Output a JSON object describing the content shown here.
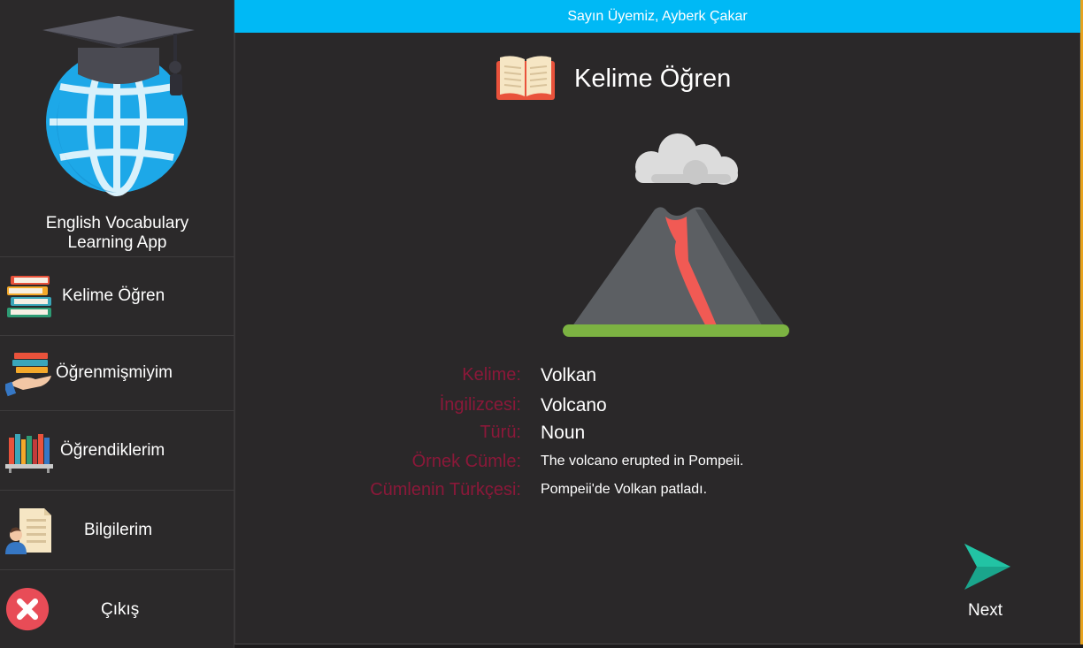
{
  "app": {
    "title_line1": "English Vocabulary",
    "title_line2": "Learning App"
  },
  "header": {
    "greeting": "Sayın Üyemiz, Ayberk Çakar"
  },
  "sidebar": {
    "items": [
      {
        "label": "Kelime Öğren",
        "icon": "books-stack-icon"
      },
      {
        "label": "Öğrenmişmiyim",
        "icon": "hand-books-icon"
      },
      {
        "label": "Öğrendiklerim",
        "icon": "bookshelf-icon"
      },
      {
        "label": "Bilgilerim",
        "icon": "user-document-icon"
      },
      {
        "label": "Çıkış",
        "icon": "exit-icon"
      }
    ]
  },
  "main": {
    "title": "Kelime Öğren",
    "title_icon": "open-book-icon",
    "image": "volcano-illustration",
    "fields": [
      {
        "label": "Kelime:",
        "value": "Volkan"
      },
      {
        "label": "İngilizcesi:",
        "value": "Volcano"
      },
      {
        "label": "Türü:",
        "value": "Noun"
      },
      {
        "label": "Örnek Cümle:",
        "value": "The volcano erupted in Pompeii."
      },
      {
        "label": "Cümlenin Türkçesi:",
        "value": "Pompeii'de Volkan patladı."
      }
    ],
    "next_label": "Next"
  },
  "colors": {
    "header_bg": "#00b9f5",
    "label_color": "#8b1839",
    "next_arrow": "#1aa58c",
    "exit_red": "#e84c57"
  }
}
